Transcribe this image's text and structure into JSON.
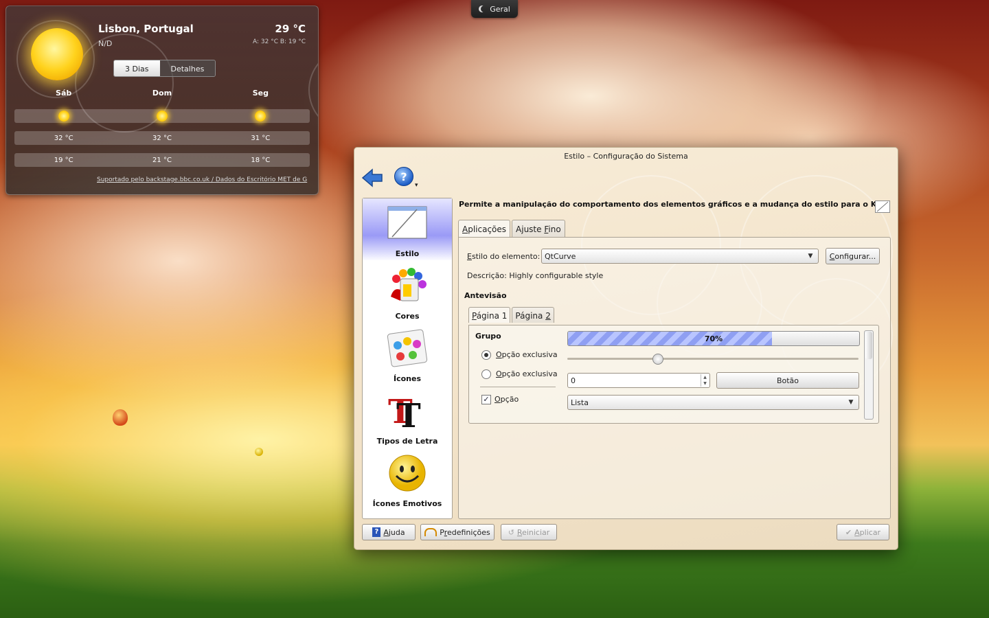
{
  "panel": {
    "tab_label": "Geral"
  },
  "weather": {
    "location": "Lisbon, Portugal",
    "condition": "N/D",
    "temperature": "29 °C",
    "hi_lo": "A: 32 °C B: 19 °C",
    "tabs": [
      "3 Dias",
      "Detalhes"
    ],
    "days": [
      "Sáb",
      "Dom",
      "Seg"
    ],
    "highs": [
      "32 °C",
      "32 °C",
      "31 °C"
    ],
    "lows": [
      "19 °C",
      "21 °C",
      "18 °C"
    ],
    "source": "Suportado pelo backstage.bbc.co.uk / Dados do Escritório MET de G"
  },
  "dialog": {
    "title": "Estilo – Configuração do Sistema",
    "description": "Permite a manipulação do comportamento dos elementos gráficos e a mudança do estilo para o KDE",
    "sidebar": [
      "Estilo",
      "Cores",
      "Ícones",
      "Tipos de Letra",
      "Ícones Emotivos"
    ],
    "tabs": {
      "t1_u": "A",
      "t1_rest": "plicações",
      "t2_pre": "Ajuste ",
      "t2_u": "F",
      "t2_rest": "ino"
    },
    "element_style": {
      "label_u": "E",
      "label_rest": "stilo do elemento:",
      "value": "QtCurve",
      "configure_u": "C",
      "configure_rest": "onfigurar..."
    },
    "style_description": "Descrição: Highly configurable style",
    "preview_title": "Antevisão",
    "preview_tabs": {
      "p1_u": "P",
      "p1_rest": "ágina 1",
      "p2_pre": "Página ",
      "p2_u": "2"
    },
    "preview": {
      "group": "Grupo",
      "progress_value": 0.7,
      "progress_label": "70%",
      "slider_value": 0.31,
      "radio1_u": "O",
      "radio1_rest": "pção exclusiva",
      "radio2_u": "O",
      "radio2_rest": "pção exclusiva",
      "checkbox_u": "O",
      "checkbox_rest": "pção",
      "spin_value": "0",
      "button": "Botão",
      "list_value": "Lista"
    },
    "buttons": {
      "help_u": "A",
      "help_rest": "juda",
      "defaults_pre": "P",
      "defaults_u": "r",
      "defaults_rest": "edefinições",
      "reset_u": "R",
      "reset_rest": "einiciar",
      "apply_u": "A",
      "apply_rest": "plicar"
    }
  }
}
